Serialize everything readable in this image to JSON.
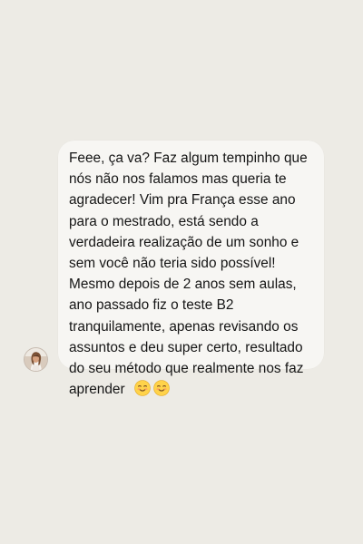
{
  "conversation": {
    "message": {
      "lines": [
        "Feee, ça va? Faz algum tempinho que",
        "nós não nos falamos mas queria te",
        "agradecer! Vim pra França esse ano",
        "para o mestrado, está sendo a",
        "verdadeira realização de um sonho e",
        "sem você não teria sido possível!",
        "Mesmo depois de 2 anos sem aulas,",
        "ano passado fiz o teste B2",
        "tranquilamente, apenas revisando os",
        "assuntos e deu super certo, resultado",
        "do seu método que realmente nos faz",
        "aprender"
      ],
      "emojis": [
        "smiling-face-emoji",
        "smiling-face-emoji"
      ]
    },
    "avatar_icon": "profile-avatar-icon"
  },
  "colors": {
    "background": "#edebe5",
    "bubble": "#f7f6f3",
    "text": "#151515",
    "emoji": "#ffd34a"
  }
}
